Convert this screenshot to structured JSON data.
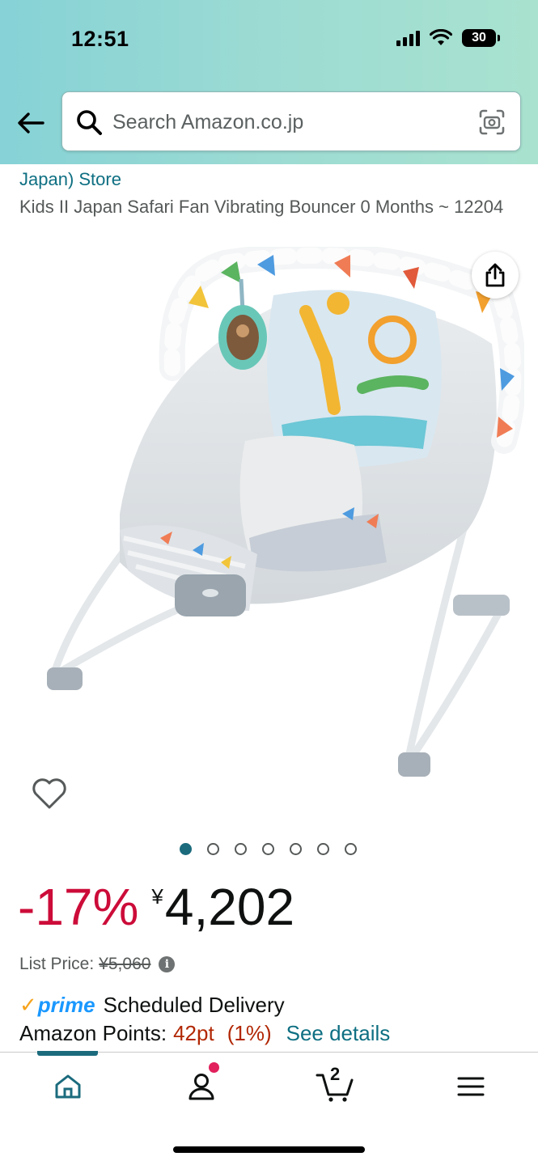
{
  "status_bar": {
    "time": "12:51",
    "battery": "30"
  },
  "search": {
    "placeholder": "Search Amazon.co.jp"
  },
  "product": {
    "store_link": "Japan) Store",
    "title": "Kids II Japan Safari Fan Vibrating Bouncer 0 Months ~ 12204",
    "image_count": 7,
    "active_image": 1
  },
  "price": {
    "discount": "-17%",
    "currency": "¥",
    "amount": "4,202",
    "list_label": "List Price:",
    "list_value": "¥5,060"
  },
  "delivery": {
    "prime_label": "prime",
    "text": "Scheduled Delivery"
  },
  "points": {
    "label": "Amazon Points:",
    "value": "42pt",
    "percent": "(1%)",
    "link": "See details"
  },
  "nav": {
    "cart_count": "2"
  },
  "colors": {
    "accent": "#1b6b7d",
    "discount": "#cc0c39",
    "link": "#0e6f82",
    "prime": "#1a98ff",
    "points": "#b12704"
  }
}
